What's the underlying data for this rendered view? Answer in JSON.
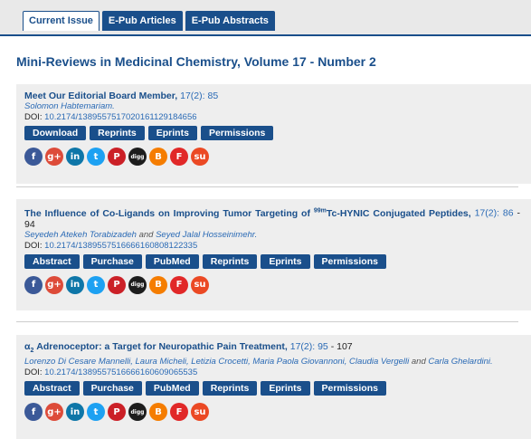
{
  "tabs": [
    "Current Issue",
    "E-Pub Articles",
    "E-Pub Abstracts"
  ],
  "issue_title": "Mini-Reviews in Medicinal Chemistry, Volume 17 - Number 2",
  "articles": [
    {
      "title": "Meet Our Editorial Board Member,",
      "volume": "17(2):",
      "pages": "85",
      "authors": "Solomon Habtemariam.",
      "doi_label": "DOI:",
      "doi": "10.2174/1389557517020161129184656",
      "buttons": [
        "Download",
        "Reprints",
        "Eprints",
        "Permissions"
      ]
    },
    {
      "title_pre": "The Influence of Co-Ligands on Improving Tumor Targeting of ",
      "title_sup": "99m",
      "title_post": "Tc-HYNIC Conjugated Peptides,",
      "volume": "17(2):",
      "pages_start": "86",
      "pages_end": " - 94",
      "authors_a": "Seyedeh Atekeh Torabizadeh",
      "authors_and": " and ",
      "authors_b": "Seyed Jalal Hosseinimehr.",
      "doi_label": "DOI:",
      "doi": "10.2174/1389557516666160808122335",
      "buttons": [
        "Abstract",
        "Purchase",
        "PubMed",
        "Reprints",
        "Eprints",
        "Permissions"
      ]
    },
    {
      "title_alpha": "α",
      "title_sub": "2",
      "title_post": " Adrenoceptor: a Target for Neuropathic Pain Treatment,",
      "volume": "17(2):",
      "pages_start": "95",
      "pages_end": " - 107",
      "authors_a": "Lorenzo Di Cesare Mannelli, Laura Micheli, Letizia Crocetti, Maria Paola Giovannoni, Claudia Vergelli",
      "authors_and": " and ",
      "authors_b": "Carla Ghelardini.",
      "doi_label": "DOI:",
      "doi": "10.2174/1389557516666160609065535",
      "buttons": [
        "Abstract",
        "Purchase",
        "PubMed",
        "Reprints",
        "Eprints",
        "Permissions"
      ]
    }
  ],
  "social": [
    {
      "name": "facebook-icon",
      "glyph": "f",
      "color": "#3b5998"
    },
    {
      "name": "googleplus-icon",
      "glyph": "g+",
      "color": "#dd4b39"
    },
    {
      "name": "linkedin-icon",
      "glyph": "in",
      "color": "#0e76a8"
    },
    {
      "name": "twitter-icon",
      "glyph": "t",
      "color": "#1da1f2"
    },
    {
      "name": "pinterest-icon",
      "glyph": "P",
      "color": "#cb2027"
    },
    {
      "name": "digg-icon",
      "glyph": "digg",
      "color": "#1d1d1d"
    },
    {
      "name": "blogger-icon",
      "glyph": "B",
      "color": "#f57d00"
    },
    {
      "name": "flipboard-icon",
      "glyph": "F",
      "color": "#e12828"
    },
    {
      "name": "stumbleupon-icon",
      "glyph": "su",
      "color": "#eb4924"
    }
  ]
}
